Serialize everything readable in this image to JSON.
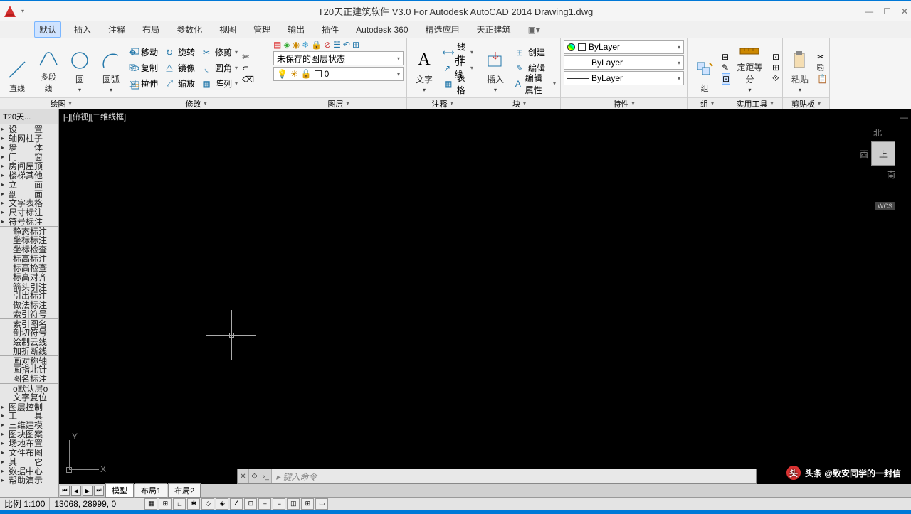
{
  "title": "T20天正建筑软件 V3.0 For Autodesk AutoCAD 2014    Drawing1.dwg",
  "menu": {
    "items": [
      "默认",
      "插入",
      "注释",
      "布局",
      "参数化",
      "视图",
      "管理",
      "输出",
      "插件",
      "Autodesk 360",
      "精选应用",
      "天正建筑"
    ],
    "active": 0
  },
  "ribbon": {
    "groups": [
      {
        "label": "绘图",
        "big_tools": [
          {
            "label": "直线",
            "icon": "line"
          },
          {
            "label": "多段线",
            "icon": "polyline"
          },
          {
            "label": "圆",
            "icon": "circle"
          },
          {
            "label": "圆弧",
            "icon": "arc"
          }
        ],
        "stack": true
      },
      {
        "label": "修改",
        "rows": [
          [
            {
              "icon": "move",
              "label": "移动"
            },
            {
              "icon": "rotate",
              "label": "旋转"
            },
            {
              "icon": "trim",
              "label": "修剪"
            }
          ],
          [
            {
              "icon": "copy",
              "label": "复制"
            },
            {
              "icon": "mirror",
              "label": "镜像"
            },
            {
              "icon": "fillet",
              "label": "圆角"
            }
          ],
          [
            {
              "icon": "stretch",
              "label": "拉伸"
            },
            {
              "icon": "scale",
              "label": "缩放"
            },
            {
              "icon": "array",
              "label": "阵列"
            }
          ]
        ]
      },
      {
        "label": "图层",
        "layer_state": "未保存的图层状态",
        "layer_value": "0"
      },
      {
        "label": "注释",
        "big_tools": [
          {
            "label": "文字",
            "icon": "text"
          }
        ],
        "rows": [
          [
            {
              "icon": "dim",
              "label": "线性"
            }
          ],
          [
            {
              "icon": "leader",
              "label": "引线"
            }
          ],
          [
            {
              "icon": "table",
              "label": "表格"
            }
          ]
        ]
      },
      {
        "label": "块",
        "big_tools": [
          {
            "label": "插入",
            "icon": "insert"
          }
        ],
        "rows": [
          [
            {
              "icon": "create",
              "label": "创建"
            }
          ],
          [
            {
              "icon": "edit",
              "label": "编辑"
            }
          ],
          [
            {
              "icon": "attr",
              "label": "编辑属性"
            }
          ]
        ]
      },
      {
        "label": "特性",
        "bylayer1": "ByLayer",
        "bylayer2": "ByLayer",
        "bylayer3": "ByLayer"
      },
      {
        "label": "组",
        "big_tools": [
          {
            "label": "组",
            "icon": "group"
          }
        ]
      },
      {
        "label": "实用工具",
        "big_tools": [
          {
            "label": "定距等分",
            "icon": "measure"
          }
        ]
      },
      {
        "label": "剪贴板",
        "big_tools": [
          {
            "label": "粘贴",
            "icon": "paste"
          }
        ]
      }
    ]
  },
  "side_panel": {
    "title": "T20天...",
    "groups": [
      [
        "设　　置",
        "轴网柱子",
        "墙　　体",
        "门　　窗",
        "房间屋顶",
        "楼梯其他",
        "立　　面",
        "剖　　面",
        "文字表格",
        "尺寸标注",
        "符号标注"
      ],
      [
        "静态标注",
        "坐标标注",
        "坐标检查",
        "标高标注",
        "标高检查",
        "标高对齐"
      ],
      [
        "箭头引注",
        "引出标注",
        "做法标注",
        "索引符号"
      ],
      [
        "索引图名",
        "剖切符号",
        "绘制云线",
        "加折断线"
      ],
      [
        "画对称轴",
        "画指北针",
        "图名标注"
      ],
      [
        "o默认层o",
        "文字复位"
      ],
      [
        "图层控制",
        "工　　具",
        "三维建模",
        "图块图案",
        "场地布置",
        "文件布图",
        "其　　它",
        "数据中心",
        "帮助演示"
      ]
    ]
  },
  "canvas": {
    "view_label": "[-][俯视][二维线框]",
    "viewcube": {
      "n": "北",
      "w": "西",
      "s": "南",
      "top": "上"
    },
    "wcs": "WCS",
    "ucs_x": "X",
    "ucs_y": "Y"
  },
  "command_line": {
    "placeholder": "键入命令"
  },
  "model_tabs": [
    "模型",
    "布局1",
    "布局2"
  ],
  "status": {
    "scale": "比例 1:100",
    "coords": "13068, 28999, 0"
  },
  "watermark": "头条 @致安同学的一封信"
}
